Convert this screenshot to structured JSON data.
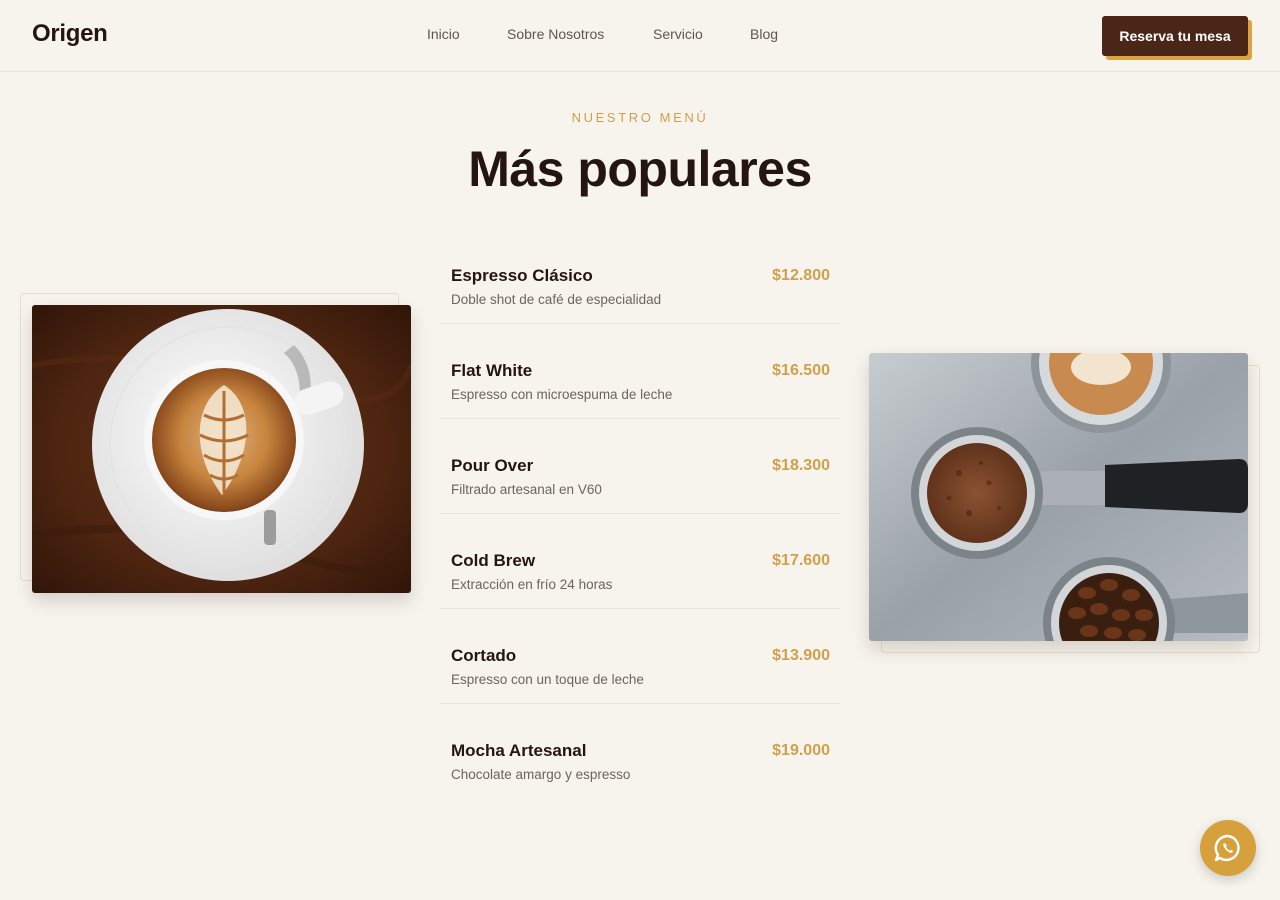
{
  "brand": {
    "logo": "Origen"
  },
  "nav": {
    "items": [
      {
        "label": "Inicio"
      },
      {
        "label": "Sobre Nosotros"
      },
      {
        "label": "Servicio"
      },
      {
        "label": "Blog"
      }
    ],
    "cta_label": "Reserva tu mesa"
  },
  "section": {
    "eyebrow": "NUESTRO MENÚ",
    "title": "Más populares"
  },
  "menu": {
    "items": [
      {
        "name": "Espresso Clásico",
        "description": "Doble shot de café de especialidad",
        "price": "$12.800"
      },
      {
        "name": "Flat White",
        "description": "Espresso con microespuma de leche",
        "price": "$16.500"
      },
      {
        "name": "Pour Over",
        "description": "Filtrado artesanal en V60",
        "price": "$18.300"
      },
      {
        "name": "Cold Brew",
        "description": "Extracción en frío 24 horas",
        "price": "$17.600"
      },
      {
        "name": "Cortado",
        "description": "Espresso con un toque de leche",
        "price": "$13.900"
      },
      {
        "name": "Mocha Artesanal",
        "description": "Chocolate amargo y espresso",
        "price": "$19.000"
      }
    ]
  },
  "images": {
    "left": "latte-art-cup-photo",
    "right": "portafilters-coffee-photo"
  },
  "icons": {
    "whatsapp": "whatsapp-icon"
  },
  "colors": {
    "background": "#f7f4ee",
    "accent": "#d2a04c",
    "brand_dark": "#4a2617",
    "text_dark": "#241510"
  }
}
